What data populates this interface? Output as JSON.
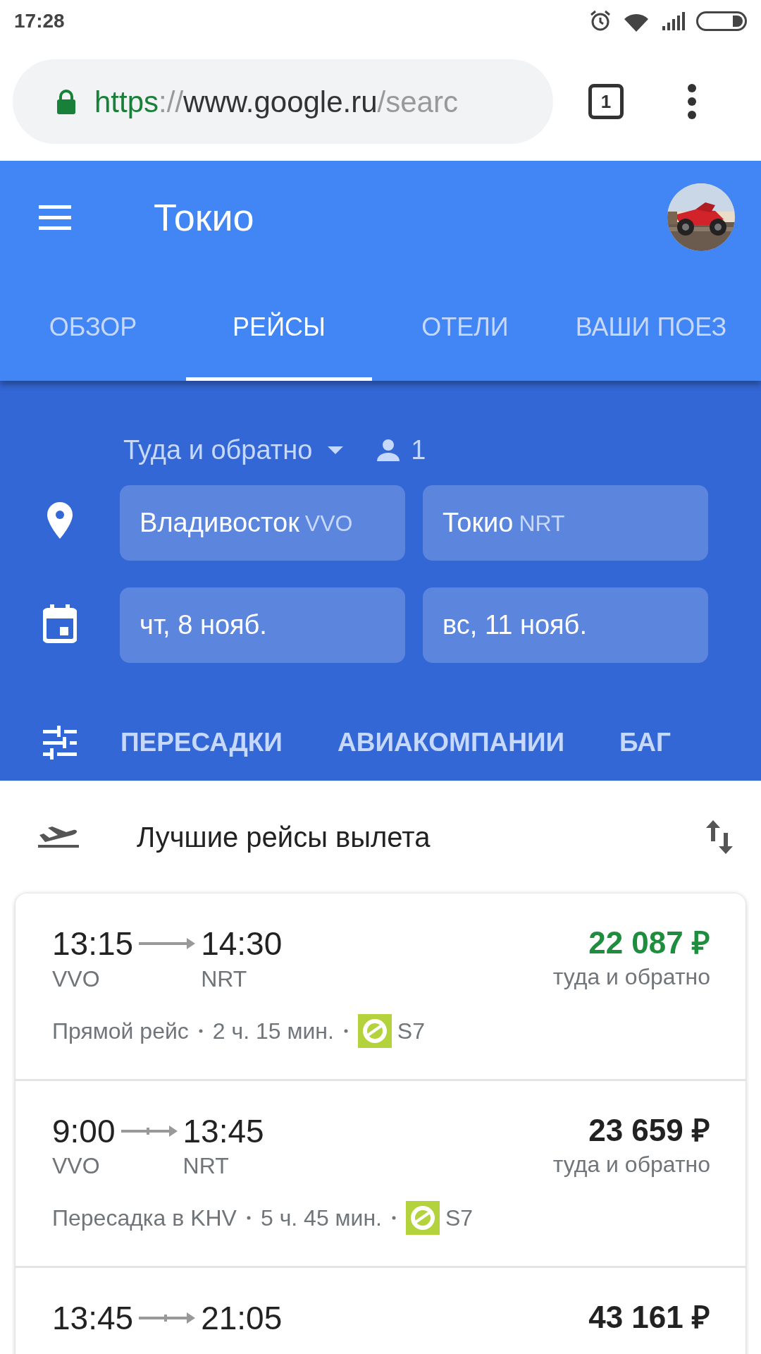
{
  "status_bar": {
    "time": "17:28"
  },
  "browser": {
    "url": {
      "scheme": "https",
      "separator": "://",
      "host": "www.google.ru",
      "path": "/searc"
    },
    "tab_count": "1"
  },
  "header": {
    "title": "Токио"
  },
  "tabs": [
    {
      "label": "ОБЗОР",
      "selected": false
    },
    {
      "label": "РЕЙСЫ",
      "selected": true
    },
    {
      "label": "ОТЕЛИ",
      "selected": false
    },
    {
      "label": "ВАШИ ПОЕЗ",
      "selected": false
    }
  ],
  "search": {
    "trip_type": "Туда и обратно",
    "passengers": "1",
    "origin": {
      "city": "Владивосток",
      "code": "VVO"
    },
    "destination": {
      "city": "Токио",
      "code": "NRT"
    },
    "depart_date": "чт, 8 нояб.",
    "return_date": "вс, 11 нояб."
  },
  "filters": [
    "ПЕРЕСАДКИ",
    "АВИАКОМПАНИИ",
    "БАГ"
  ],
  "results": {
    "title": "Лучшие рейсы вылета",
    "flights": [
      {
        "kind": "direct",
        "depart_time": "13:15",
        "arrive_time": "14:30",
        "from": "VVO",
        "to": "NRT",
        "price": "22 087 ₽",
        "best": true,
        "price_note": "туда и обратно",
        "summary": "Прямой рейс",
        "duration": "2 ч. 15 мин.",
        "airline": "S7"
      },
      {
        "kind": "connecting",
        "depart_time": "9:00",
        "arrive_time": "13:45",
        "from": "VVO",
        "to": "NRT",
        "price": "23 659 ₽",
        "best": false,
        "price_note": "туда и обратно",
        "summary": "Пересадка в KHV",
        "duration": "5 ч. 45 мин.",
        "airline": "S7"
      },
      {
        "kind": "connecting",
        "depart_time": "13:45",
        "arrive_time": "21:05",
        "price": "43 161 ₽",
        "best": false
      }
    ]
  }
}
